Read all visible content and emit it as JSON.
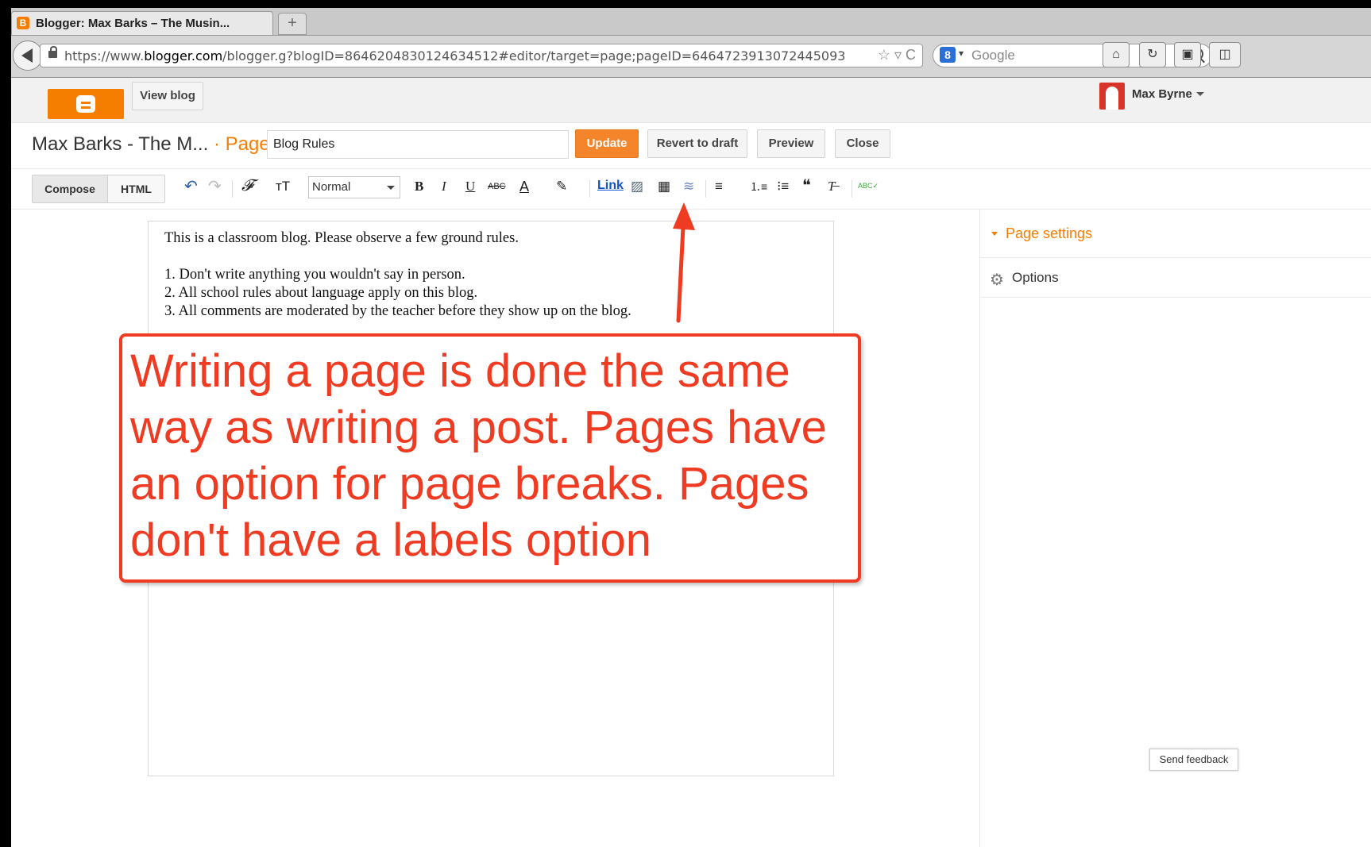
{
  "browser": {
    "tab_title": "Blogger: Max Barks – The Musin...",
    "tab_favicon_letter": "B",
    "new_tab_glyph": "+",
    "url_prefix": "https://www.",
    "url_domain": "blogger.com",
    "url_path": "/blogger.g?blogID=8646204830124634512#editor/target=page;pageID=6464723913072445093",
    "url_actions": "☆ ▿ C",
    "search_engine_letter": "8",
    "search_placeholder": "Google",
    "nav_icons": {
      "home": "⌂",
      "sync": "↻",
      "screenshot": "▣",
      "addon": "◫"
    }
  },
  "header": {
    "view_blog_label": "View blog",
    "user_name": "Max Byrne"
  },
  "titlebar": {
    "blog_title": "Max Barks - The M...",
    "separator": " · ",
    "page_crumb": "Page",
    "page_title_value": "Blog Rules",
    "update_label": "Update",
    "revert_label": "Revert to draft",
    "preview_label": "Preview",
    "close_label": "Close"
  },
  "toolbar": {
    "compose_label": "Compose",
    "html_label": "HTML",
    "undo": "↶",
    "redo": "↷",
    "font_family": "𝓕",
    "font_size": "тT",
    "format_value": "Normal",
    "bold": "B",
    "italic": "I",
    "underline": "U",
    "strike": "ABC",
    "text_color": "A",
    "highlight": "✎",
    "link_label": "Link",
    "image": "▨",
    "video": "▦",
    "page_break": "≋",
    "align": "≡",
    "numbered_list": "⒈≡",
    "bullet_list": "⁝≡",
    "quote": "❝",
    "clear_format": "T̶",
    "spellcheck": "ABC✓"
  },
  "editor": {
    "lines": [
      "This is a classroom blog. Please observe a few ground rules.",
      "",
      "1. Don't write anything you wouldn't say in person.",
      "2. All school rules about language apply on this blog.",
      "3. All comments are moderated by the teacher before they show up on the blog."
    ]
  },
  "sidebar": {
    "page_settings_label": "Page settings",
    "options_label": "Options"
  },
  "feedback_label": "Send feedback",
  "callout": {
    "text": "Writing a page is done the same way as writing a post. Pages have an option for page breaks. Pages don't have a labels option"
  },
  "colors": {
    "accent": "#f57d00",
    "callout_red": "#ee3b22",
    "link_blue": "#1155cc"
  }
}
